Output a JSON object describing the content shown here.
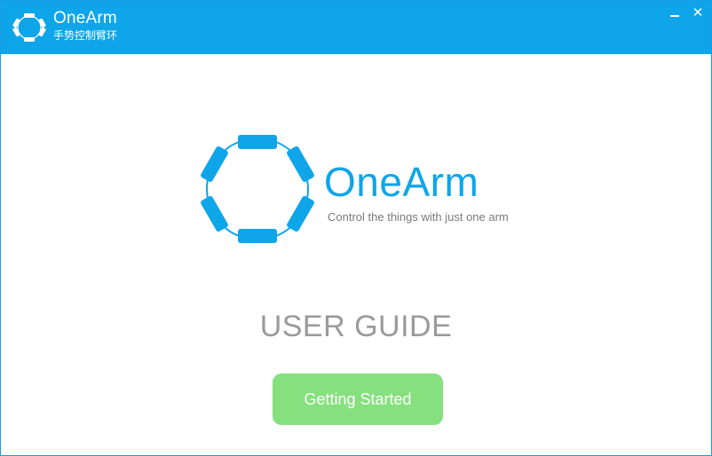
{
  "window": {
    "title": "OneArm",
    "subtitle": "手势控制臂环",
    "controls": {
      "minimize_icon": "minimize-icon",
      "close_icon": "close-icon",
      "close_glyph": "✕"
    }
  },
  "hero": {
    "logo_icon": "hexagon-armband-logo",
    "brand_name": "OneArm",
    "tagline": "Control the things with just one arm"
  },
  "main": {
    "guide_title": "USER GUIDE",
    "start_button_label": "Getting Started"
  },
  "colors": {
    "brand_blue": "#0ea5e9",
    "button_green": "#86e07e",
    "heading_gray": "#9a9a9a",
    "tagline_gray": "#7a7a7a"
  }
}
